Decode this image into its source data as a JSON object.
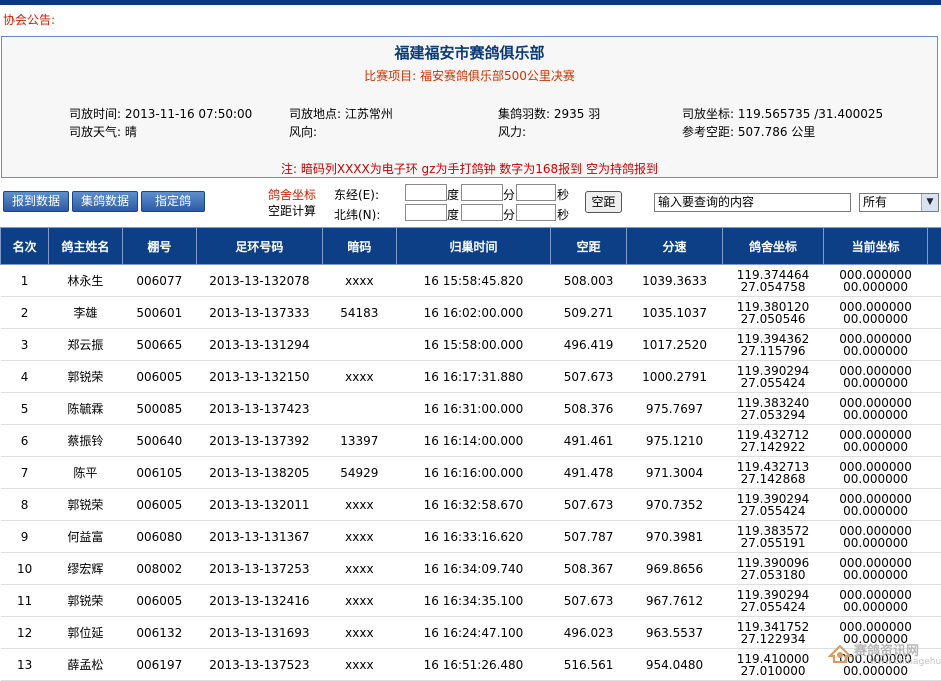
{
  "notice": {
    "label": "协会公告:"
  },
  "race": {
    "club_title": "福建福安市赛鸽俱乐部",
    "project": "比赛项目: 福安赛鸽俱乐部500公里决赛",
    "release_time": "司放时间: 2013-11-16 07:50:00",
    "release_place": "司放地点: 江苏常州",
    "pigeon_count": "集鸽羽数: 2935 羽",
    "release_coords": "司放坐标: 119.565735 /31.400025",
    "weather": "司放天气: 晴",
    "wind_direction": "风向:",
    "wind_force": "风力:",
    "ref_distance": "参考空距: 507.786 公里",
    "note": "注: 暗码列XXXX为电子环 gz为手打鸽钟 数字为168报到 空为持鸽报到"
  },
  "toolbar": {
    "report_button": "报到数据",
    "collect_button": "集鸽数据",
    "designate_button": "指定鸽",
    "coord_label_1": "鸽舍坐标",
    "coord_label_2": "空距计算",
    "east_label": "东经(E):",
    "north_label": "北纬(N):",
    "deg": "度",
    "min": "分",
    "sec": "秒",
    "distance_button": "空距",
    "search_placeholder": "输入要查询的内容",
    "filter_value": "所有"
  },
  "table": {
    "headers": [
      "名次",
      "鸽主姓名",
      "棚号",
      "足环号码",
      "暗码",
      "归巢时间",
      "空距",
      "分速",
      "鸽舍坐标",
      "当前坐标"
    ],
    "rows": [
      {
        "rank": "1",
        "owner": "林永生",
        "loft": "006077",
        "ring": "2013-13-132078",
        "code": "xxxx",
        "time": "16 15:58:45.820",
        "distance": "508.003",
        "speed": "1039.3633",
        "loft_lon": "119.374464",
        "loft_lat": "27.054758",
        "cur_lon": "000.000000",
        "cur_lat": "00.000000"
      },
      {
        "rank": "2",
        "owner": "李雄",
        "loft": "500601",
        "ring": "2013-13-137333",
        "code": "54183",
        "time": "16 16:02:00.000",
        "distance": "509.271",
        "speed": "1035.1037",
        "loft_lon": "119.380120",
        "loft_lat": "27.050546",
        "cur_lon": "000.000000",
        "cur_lat": "00.000000"
      },
      {
        "rank": "3",
        "owner": "郑云振",
        "loft": "500665",
        "ring": "2013-13-131294",
        "code": "",
        "time": "16 15:58:00.000",
        "distance": "496.419",
        "speed": "1017.2520",
        "loft_lon": "119.394362",
        "loft_lat": "27.115796",
        "cur_lon": "000.000000",
        "cur_lat": "00.000000"
      },
      {
        "rank": "4",
        "owner": "郭锐荣",
        "loft": "006005",
        "ring": "2013-13-132150",
        "code": "xxxx",
        "time": "16 16:17:31.880",
        "distance": "507.673",
        "speed": "1000.2791",
        "loft_lon": "119.390294",
        "loft_lat": "27.055424",
        "cur_lon": "000.000000",
        "cur_lat": "00.000000"
      },
      {
        "rank": "5",
        "owner": "陈毓霖",
        "loft": "500085",
        "ring": "2013-13-137423",
        "code": "",
        "time": "16 16:31:00.000",
        "distance": "508.376",
        "speed": "975.7697",
        "loft_lon": "119.383240",
        "loft_lat": "27.053294",
        "cur_lon": "000.000000",
        "cur_lat": "00.000000"
      },
      {
        "rank": "6",
        "owner": "蔡振铃",
        "loft": "500640",
        "ring": "2013-13-137392",
        "code": "13397",
        "time": "16 16:14:00.000",
        "distance": "491.461",
        "speed": "975.1210",
        "loft_lon": "119.432712",
        "loft_lat": "27.142922",
        "cur_lon": "000.000000",
        "cur_lat": "00.000000"
      },
      {
        "rank": "7",
        "owner": "陈平",
        "loft": "006105",
        "ring": "2013-13-138205",
        "code": "54929",
        "time": "16 16:16:00.000",
        "distance": "491.478",
        "speed": "971.3004",
        "loft_lon": "119.432713",
        "loft_lat": "27.142868",
        "cur_lon": "000.000000",
        "cur_lat": "00.000000"
      },
      {
        "rank": "8",
        "owner": "郭锐荣",
        "loft": "006005",
        "ring": "2013-13-132011",
        "code": "xxxx",
        "time": "16 16:32:58.670",
        "distance": "507.673",
        "speed": "970.7352",
        "loft_lon": "119.390294",
        "loft_lat": "27.055424",
        "cur_lon": "000.000000",
        "cur_lat": "00.000000"
      },
      {
        "rank": "9",
        "owner": "何益富",
        "loft": "006080",
        "ring": "2013-13-131367",
        "code": "xxxx",
        "time": "16 16:33:16.620",
        "distance": "507.787",
        "speed": "970.3981",
        "loft_lon": "119.383572",
        "loft_lat": "27.055191",
        "cur_lon": "000.000000",
        "cur_lat": "00.000000"
      },
      {
        "rank": "10",
        "owner": "缪宏辉",
        "loft": "008002",
        "ring": "2013-13-137253",
        "code": "xxxx",
        "time": "16 16:34:09.740",
        "distance": "508.367",
        "speed": "969.8656",
        "loft_lon": "119.390096",
        "loft_lat": "27.053180",
        "cur_lon": "000.000000",
        "cur_lat": "00.000000"
      },
      {
        "rank": "11",
        "owner": "郭锐荣",
        "loft": "006005",
        "ring": "2013-13-132416",
        "code": "xxxx",
        "time": "16 16:34:35.100",
        "distance": "507.673",
        "speed": "967.7612",
        "loft_lon": "119.390294",
        "loft_lat": "27.055424",
        "cur_lon": "000.000000",
        "cur_lat": "00.000000"
      },
      {
        "rank": "12",
        "owner": "郭位延",
        "loft": "006132",
        "ring": "2013-13-131693",
        "code": "xxxx",
        "time": "16 16:24:47.100",
        "distance": "496.023",
        "speed": "963.5537",
        "loft_lon": "119.341752",
        "loft_lat": "27.122934",
        "cur_lon": "000.000000",
        "cur_lat": "00.000000"
      },
      {
        "rank": "13",
        "owner": "薛孟松",
        "loft": "006197",
        "ring": "2013-13-137523",
        "code": "xxxx",
        "time": "16 16:51:26.480",
        "distance": "516.561",
        "speed": "954.0480",
        "loft_lon": "119.410000",
        "loft_lat": "27.010000",
        "cur_lon": "000.000000",
        "cur_lat": "00.000000"
      }
    ]
  },
  "watermark": {
    "text": "赛鸽资讯网",
    "sub": "www.chinagehui.com"
  },
  "colors": {
    "header_bg": "#0d3f86",
    "accent_red": "#cc0000",
    "title_blue": "#0b3a78"
  }
}
